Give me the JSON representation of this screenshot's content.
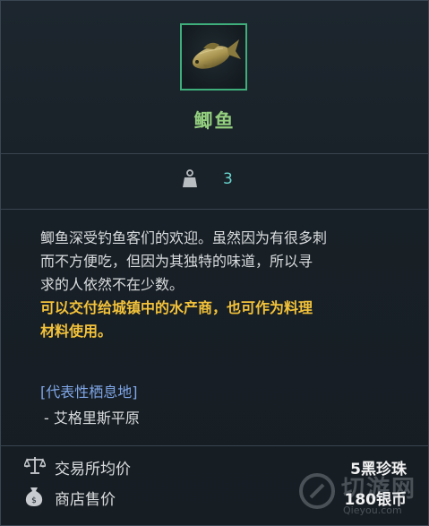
{
  "item": {
    "name": "鲫鱼",
    "icon": "fish-icon",
    "frame_color": "#3fae7b",
    "name_color": "#93cf7e"
  },
  "weight": {
    "icon": "weight-icon",
    "value": "3",
    "value_color": "#69d6cf"
  },
  "description": {
    "line1": "鲫鱼深受钓鱼客们的欢迎。虽然因为有很多刺",
    "line2": "而不方便吃，但因为其独特的味道，所以寻",
    "line3": "求的人依然不在少数。",
    "highlight_line1": "可以交付给城镇中的水产商，也可作为料理",
    "highlight_line2": "材料使用。",
    "highlight_color": "#f3c23a"
  },
  "habitat": {
    "title": "[代表性栖息地]",
    "items": [
      "- 艾格里斯平原"
    ],
    "title_color": "#7fa6e8"
  },
  "prices": [
    {
      "icon": "scales-icon",
      "label": "交易所均价",
      "value": "5黑珍珠"
    },
    {
      "icon": "money-bag-icon",
      "label": "商店售价",
      "value": "180银币"
    }
  ],
  "watermark": {
    "text": "切游网",
    "sub": "Qieyou.com"
  }
}
